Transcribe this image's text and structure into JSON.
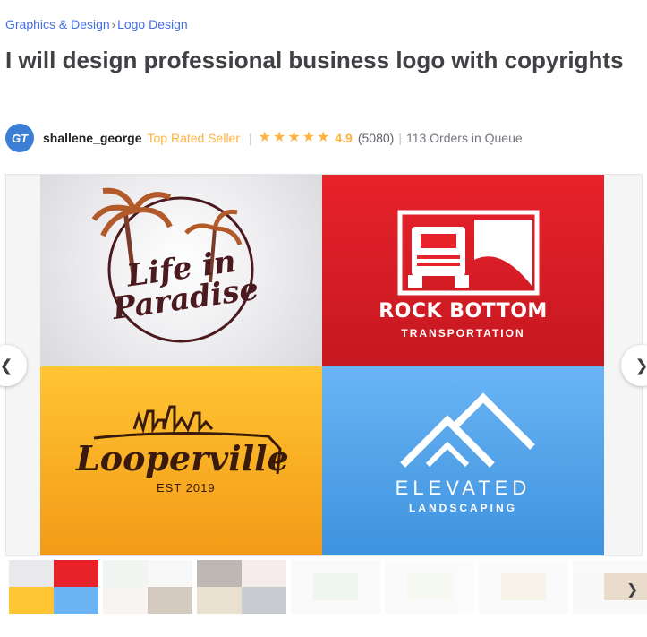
{
  "breadcrumb": {
    "category": "Graphics & Design",
    "separator": "›",
    "subcategory": "Logo Design"
  },
  "gig": {
    "title": "I will design professional business logo with copyrights"
  },
  "seller": {
    "avatar_initials": "GT",
    "username": "shallene_george",
    "level": "Top Rated Seller",
    "rating": "4.9",
    "reviews": "(5080)",
    "orders_in_queue": "113 Orders in Queue",
    "star_count": 5
  },
  "gallery": {
    "logos": {
      "paradise_line1": "Life in",
      "paradise_line2": "Paradise",
      "rock_title": "ROCK BOTTOM",
      "rock_subtitle": "TRANSPORTATION",
      "looper_title": "Looperville",
      "looper_est": "EST 2019",
      "elevated_title": "ELEVATED",
      "elevated_subtitle": "LANDSCAPING"
    },
    "prev_icon": "chevron-left-icon",
    "next_icon": "chevron-right-icon",
    "thumbnails_count": 7
  },
  "colors": {
    "link": "#446ee7",
    "top_rated": "#ffb33e",
    "star": "#ffb33e",
    "red_tile": "#e8222b",
    "yellow_tile": "#ffc533",
    "blue_tile": "#6ab4f4",
    "avatar": "#3a7fd5"
  }
}
